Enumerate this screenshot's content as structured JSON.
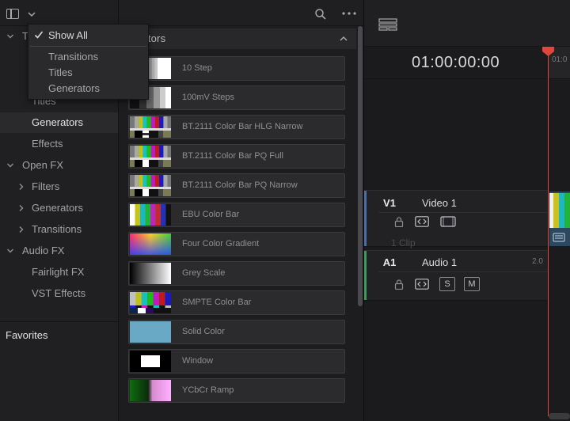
{
  "left_panel": {
    "tree": [
      {
        "label": "T",
        "indent": 0,
        "expandable": true,
        "expanded": true
      },
      {
        "label": "Titles",
        "indent": 1,
        "expandable": false
      },
      {
        "label": "Generators",
        "indent": 1,
        "expandable": false,
        "selected": true
      },
      {
        "label": "Effects",
        "indent": 1,
        "expandable": false
      },
      {
        "label": "Open FX",
        "indent": 0,
        "expandable": true,
        "expanded": true
      },
      {
        "label": "Filters",
        "indent": 1,
        "expandable": true,
        "expanded": false
      },
      {
        "label": "Generators",
        "indent": 1,
        "expandable": true,
        "expanded": false
      },
      {
        "label": "Transitions",
        "indent": 1,
        "expandable": true,
        "expanded": false
      },
      {
        "label": "Audio FX",
        "indent": 0,
        "expandable": true,
        "expanded": true
      },
      {
        "label": "Fairlight FX",
        "indent": 1,
        "expandable": false
      },
      {
        "label": "VST Effects",
        "indent": 1,
        "expandable": false
      }
    ],
    "favorites_label": "Favorites"
  },
  "dropdown": {
    "items": [
      "Show All",
      "Transitions",
      "Titles",
      "Generators"
    ],
    "checked_item": "Show All"
  },
  "generators_panel": {
    "section_title": "nerators",
    "items": [
      {
        "name": "10 Step",
        "thumb": "10-step"
      },
      {
        "name": "100mV Steps",
        "thumb": "100mv-steps"
      },
      {
        "name": "BT.2111 Color Bar HLG Narrow",
        "thumb": "color-bars-hlg"
      },
      {
        "name": "BT.2111 Color Bar PQ Full",
        "thumb": "color-bars-pq"
      },
      {
        "name": "BT.2111 Color Bar PQ Narrow",
        "thumb": "color-bars-pq"
      },
      {
        "name": "EBU Color Bar",
        "thumb": "ebu-bars"
      },
      {
        "name": "Four Color Gradient",
        "thumb": "four-color-gradient"
      },
      {
        "name": "Grey Scale",
        "thumb": "grey-scale"
      },
      {
        "name": "SMPTE Color Bar",
        "thumb": "smpte-bars"
      },
      {
        "name": "Solid Color",
        "thumb": "solid-color"
      },
      {
        "name": "Window",
        "thumb": "window"
      },
      {
        "name": "YCbCr Ramp",
        "thumb": "ycbcr-ramp"
      }
    ]
  },
  "timeline": {
    "timecode": "01:00:00:00",
    "ruler_label": "01:0",
    "tracks": [
      {
        "id": "V1",
        "name": "Video 1",
        "clip_count": "1 Clip",
        "color": "#4a6fa8"
      },
      {
        "id": "A1",
        "name": "Audio 1",
        "channels": "2.0",
        "color": "#3f9a5b",
        "solo": "S",
        "mute": "M"
      }
    ],
    "playhead_color": "#e0463b"
  }
}
